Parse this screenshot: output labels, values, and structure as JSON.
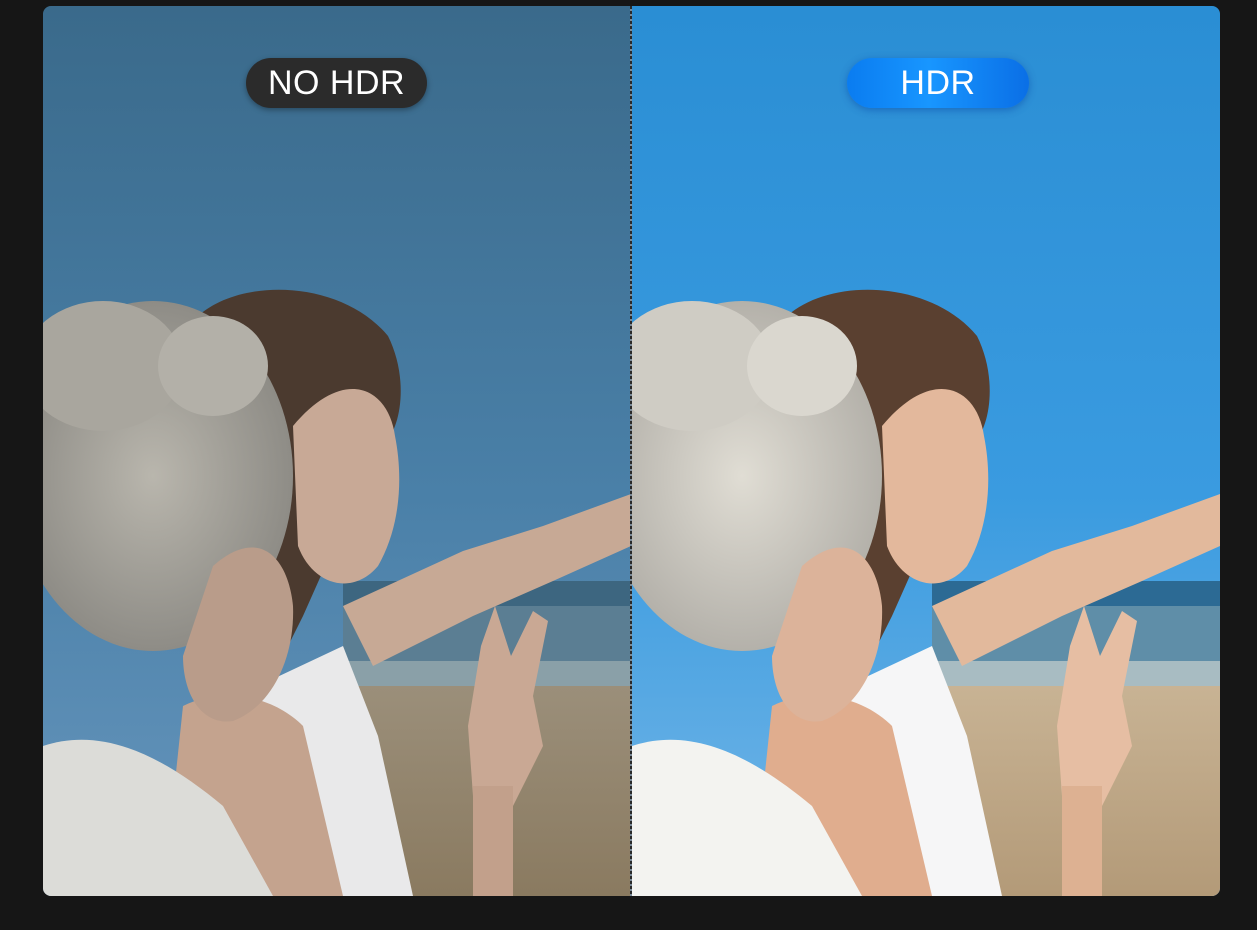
{
  "comparison": {
    "left_label": "NO HDR",
    "right_label": "HDR"
  },
  "colors": {
    "page_background": "#161616",
    "no_hdr_pill": "#2b2b2b",
    "hdr_pill": "#1490ff",
    "no_hdr_sky_top": "#3b6b8c",
    "hdr_sky_top": "#2a8fd6"
  },
  "images": {
    "left": "beach-photo-no-hdr",
    "right": "beach-photo-hdr"
  }
}
